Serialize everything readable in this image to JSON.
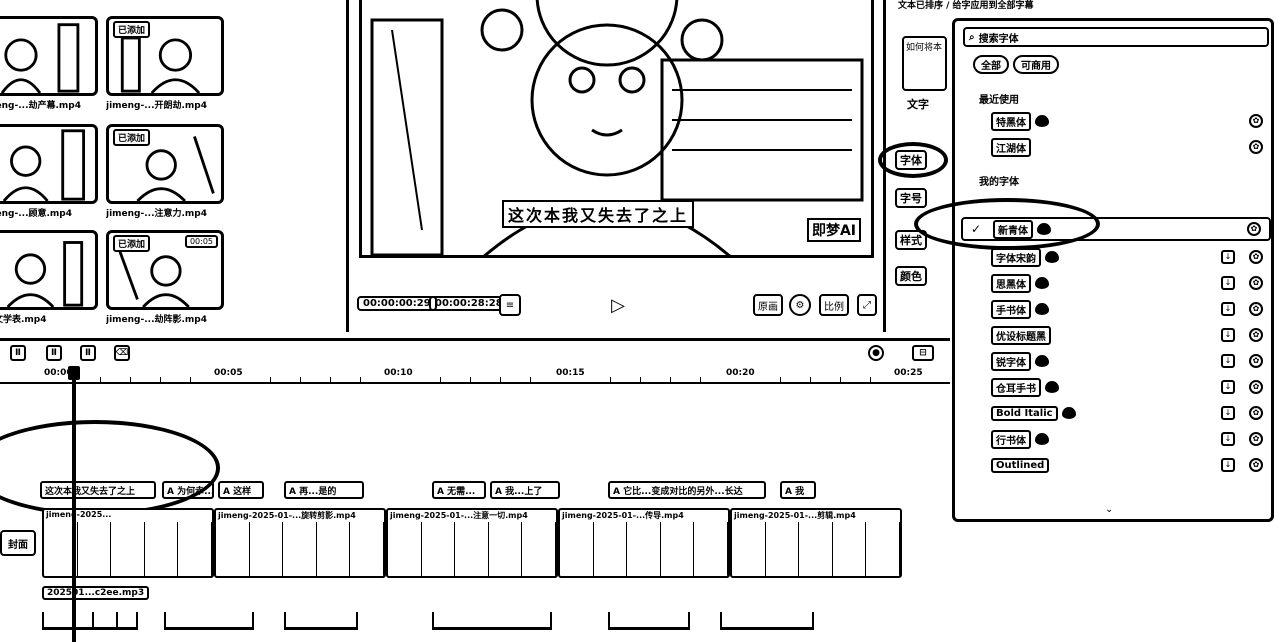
{
  "media": {
    "thumbnails": [
      {
        "tag": "",
        "duration": "",
        "name": "jimeng-...劫产幕.mp4"
      },
      {
        "tag": "已添加",
        "duration": "",
        "name": "jimeng-...开朗劫.mp4"
      },
      {
        "tag": "",
        "duration": "",
        "name": "jimeng-...顾意.mp4"
      },
      {
        "tag": "已添加",
        "duration": "",
        "name": "jimeng-...注意力.mp4"
      },
      {
        "tag": "",
        "duration": "",
        "name": "...-文学表.mp4"
      },
      {
        "tag": "已添加",
        "duration": "00:05",
        "name": "jimeng-...劫阵影.mp4"
      }
    ]
  },
  "player": {
    "subtitle_overlay": "这次本我又失去了之上",
    "ai_mark": "即梦AI",
    "current_time": "00:00:00:29",
    "total_time": "00:00:28:28",
    "buttons": {
      "ratio": "原画",
      "fullscreen": "比例"
    }
  },
  "inspector": {
    "top_label": "文本已排序 / 给字应用到全部字幕",
    "text_preview": "如何将本",
    "tabs": [
      "字体",
      "字号",
      "样式",
      "颜色"
    ],
    "text_link": "文字"
  },
  "font_panel": {
    "search_label": "搜索字体",
    "filters": [
      "全部",
      "可商用"
    ],
    "sections": {
      "recent": "最近使用",
      "all": "我的字体"
    },
    "recent_fonts": [
      {
        "name": "特黑体",
        "heart": true
      },
      {
        "name": "江湖体",
        "heart": false
      }
    ],
    "fonts": [
      {
        "name": "新青体",
        "heart": true,
        "selected": true
      },
      {
        "name": "字体宋韵",
        "heart": true
      },
      {
        "name": "思黑体",
        "heart": true
      },
      {
        "name": "手书体",
        "heart": true
      },
      {
        "name": "优设标题黑",
        "heart": false
      },
      {
        "name": "锐字体",
        "heart": true
      },
      {
        "name": "仓耳手书",
        "heart": true
      },
      {
        "name": "Bold Italic",
        "heart": true
      },
      {
        "name": "行书体",
        "heart": true
      },
      {
        "name": "Outlined",
        "heart": false
      }
    ]
  },
  "timeline": {
    "ruler": [
      "00:00",
      "00:05",
      "00:10",
      "00:15",
      "00:20",
      "00:25"
    ],
    "text_clips": [
      "这次本我又失去了之上",
      "A 为何幸...",
      "A 这样",
      "A 再...是的",
      "A 无需...",
      "A 我...上了",
      "A 它比...变成对比的另外...长达",
      "A 我"
    ],
    "video_clips": [
      "jimeng-2025...",
      "jimeng-2025-01-...旋转剪影.mp4",
      "jimeng-2025-01-...注意一切.mp4",
      "jimeng-2025-01-...传导.mp4",
      "jimeng-2025-01-...剪辑.mp4"
    ],
    "cover_label": "封面",
    "audio_label": "202501...c2ee.mp3"
  }
}
